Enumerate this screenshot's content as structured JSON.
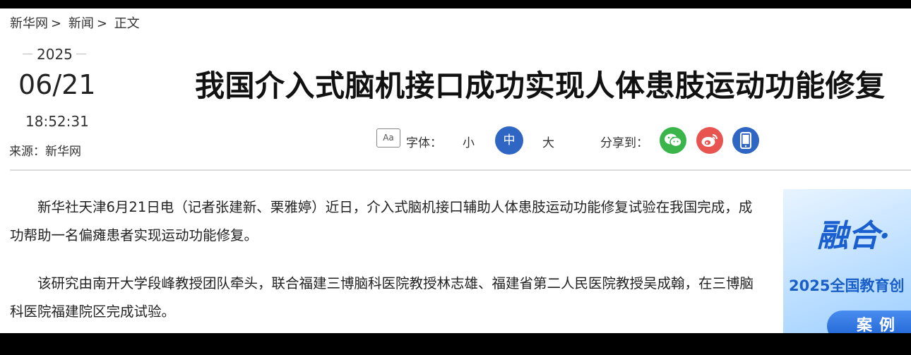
{
  "breadcrumb": {
    "items": [
      "新华网",
      "新闻",
      "正文"
    ],
    "separator": ">"
  },
  "meta": {
    "year": "2025",
    "date": "06/21",
    "time": "18:52:31",
    "source": "来源：新华网"
  },
  "article": {
    "title": "我国介入式脑机接口成功实现人体患肢运动功能修复",
    "paragraphs": [
      "新华社天津6月21日电（记者张建新、栗雅婷）近日，介入式脑机接口辅助人体患肢运动功能修复试验在我国完成，成功帮助一名偏瘫患者实现运动功能修复。",
      "该研究由南开大学段峰教授团队牵头，联合福建三博脑科医院教授林志雄、福建省第二人民医院教授吴成翰，在三博脑科医院福建院区完成试验。"
    ]
  },
  "toolbar": {
    "font_icon_text": "Aa",
    "font_label": "字体：",
    "size_small": "小",
    "size_medium": "中",
    "size_large": "大",
    "share_label": "分享到：",
    "share_icons": [
      "wechat-icon",
      "weibo-icon",
      "mobile-icon"
    ],
    "colors": {
      "active_size": "#2f66c3",
      "wechat": "#39b54a",
      "weibo": "#e8544f",
      "mobile": "#2f66c3"
    }
  },
  "banner": {
    "headline": "融合·",
    "subtitle": "2025全国教育创",
    "button": "案例"
  }
}
